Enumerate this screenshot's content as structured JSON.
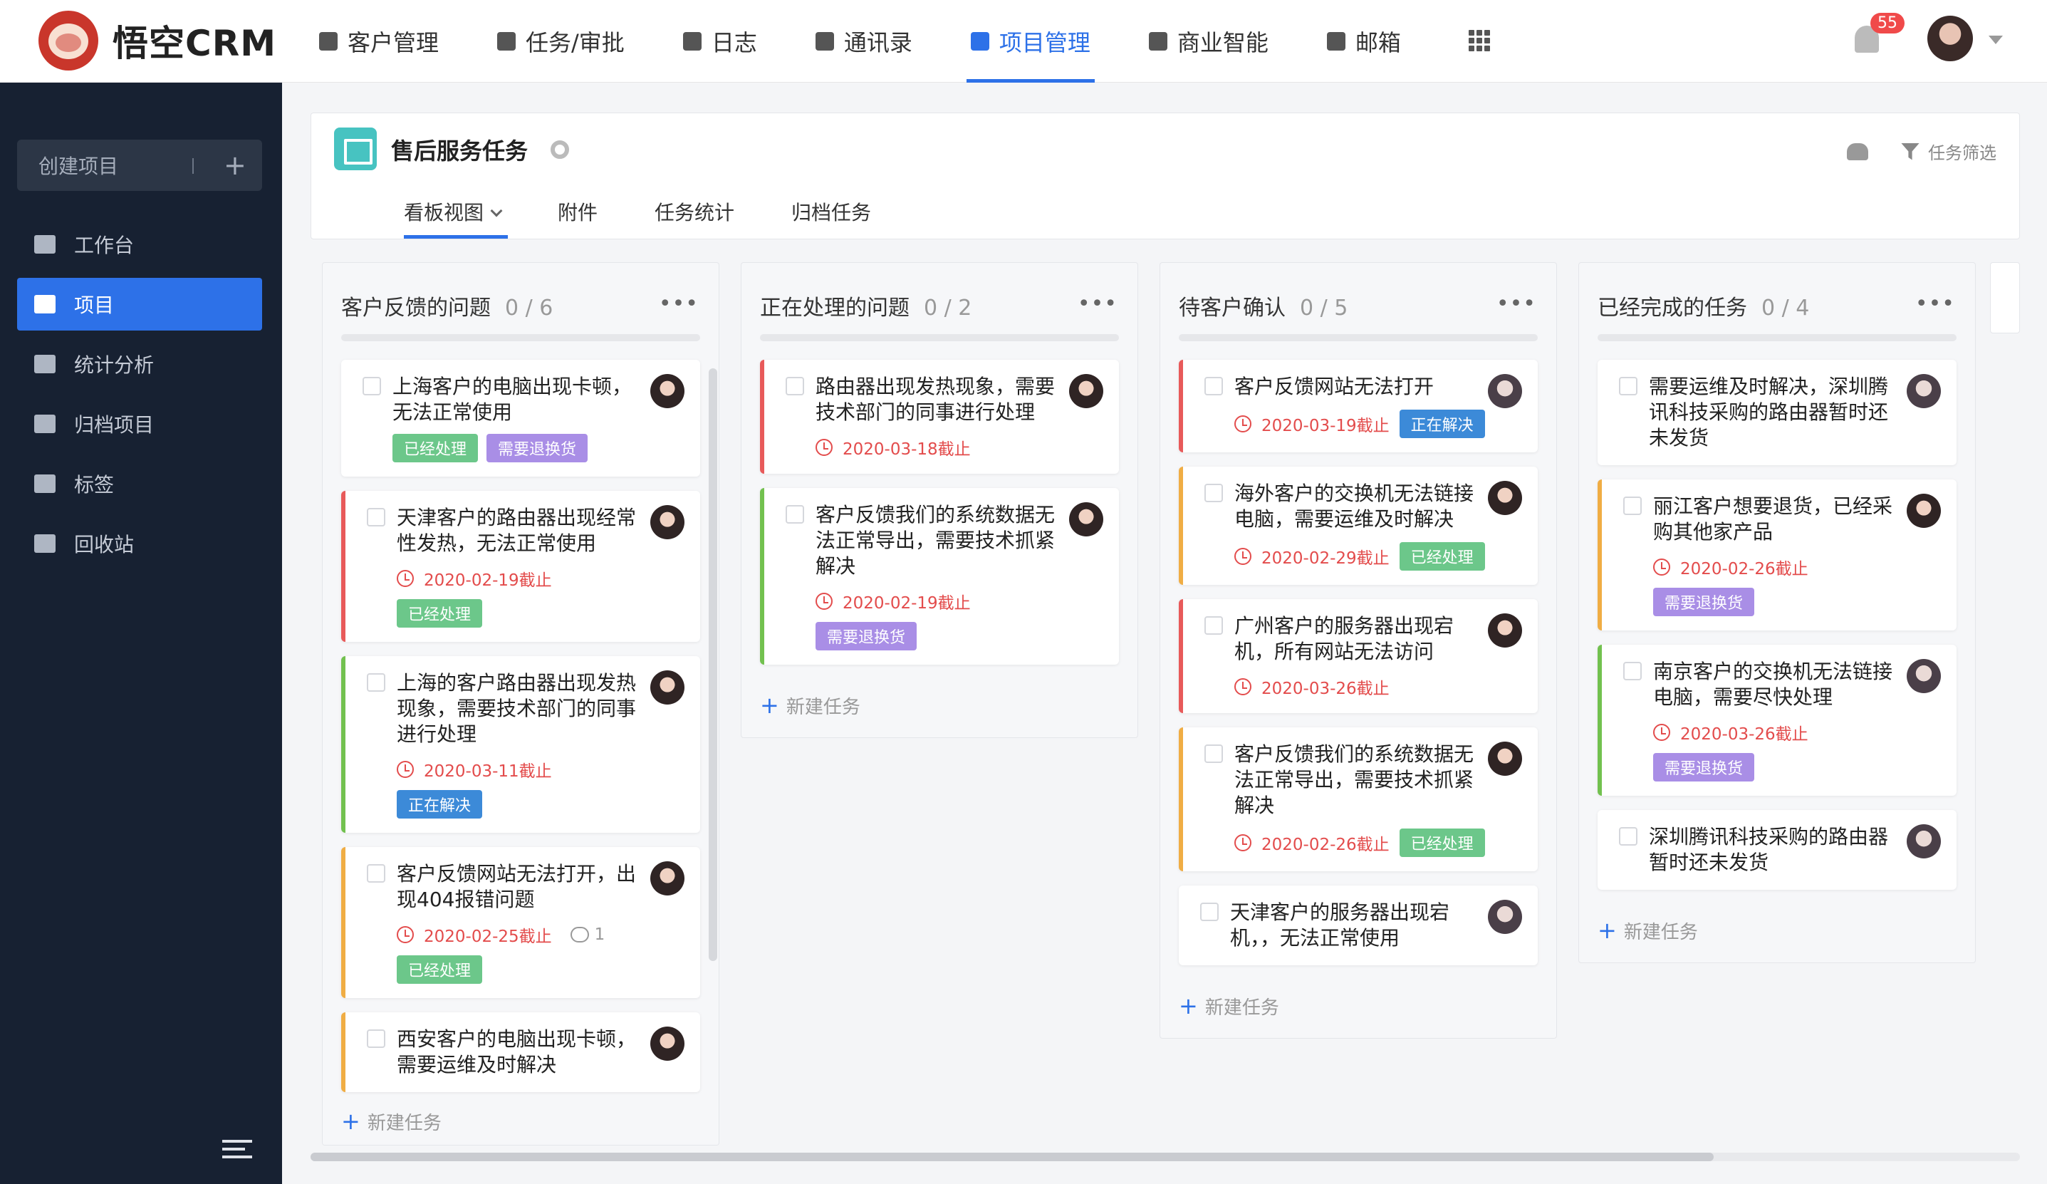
{
  "brand": {
    "name": "悟空CRM"
  },
  "nav": [
    {
      "label": "客户管理",
      "icon": "building-icon"
    },
    {
      "label": "任务/审批",
      "icon": "briefcase-icon"
    },
    {
      "label": "日志",
      "icon": "notebook-icon"
    },
    {
      "label": "通讯录",
      "icon": "phone-book-icon"
    },
    {
      "label": "项目管理",
      "icon": "project-icon",
      "active": true
    },
    {
      "label": "商业智能",
      "icon": "shield-icon"
    },
    {
      "label": "邮箱",
      "icon": "mail-icon"
    }
  ],
  "notifications": {
    "count": "55"
  },
  "sidebar": {
    "create": {
      "label": "创建项目",
      "plus": "+"
    },
    "items": [
      {
        "label": "工作台",
        "icon": "monitor-icon"
      },
      {
        "label": "项目",
        "icon": "list-icon",
        "active": true
      },
      {
        "label": "统计分析",
        "icon": "bar-chart-icon"
      },
      {
        "label": "归档项目",
        "icon": "archive-icon"
      },
      {
        "label": "标签",
        "icon": "tag-icon"
      },
      {
        "label": "回收站",
        "icon": "trash-icon"
      }
    ]
  },
  "project": {
    "title": "售后服务任务",
    "filter_label": "任务筛选",
    "tabs": [
      "看板视图",
      "附件",
      "任务统计",
      "归档任务"
    ]
  },
  "new_task_label": "新建任务",
  "columns": [
    {
      "title": "客户反馈的问题",
      "count": "0 / 6",
      "tasks": [
        {
          "title": "上海客户的电脑出现卡顿，无法正常使用",
          "color": "none",
          "due": "",
          "tags": [
            {
              "t": "已经处理",
              "c": "g"
            },
            {
              "t": "需要退换货",
              "c": "p"
            }
          ]
        },
        {
          "title": "天津客户的路由器出现经常性发热，无法正常使用",
          "color": "red",
          "due": "2020-02-19截止",
          "tags": [
            {
              "t": "已经处理",
              "c": "g"
            }
          ]
        },
        {
          "title": "上海的客户路由器出现发热现象，需要技术部门的同事进行处理",
          "color": "green",
          "due": "2020-03-11截止",
          "tags": [
            {
              "t": "正在解决",
              "c": "bl"
            }
          ]
        },
        {
          "title": "客户反馈网站无法打开，出现404报错问题",
          "color": "orange",
          "due": "2020-02-25截止",
          "comments": "1",
          "tags": [
            {
              "t": "已经处理",
              "c": "g"
            }
          ]
        },
        {
          "title": "西安客户的电脑出现卡顿，需要运维及时解决",
          "color": "orange",
          "due": "",
          "tags": []
        }
      ]
    },
    {
      "title": "正在处理的问题",
      "count": "0 / 2",
      "tasks": [
        {
          "title": "路由器出现发热现象，需要技术部门的同事进行处理",
          "color": "red",
          "due": "2020-03-18截止",
          "tags": []
        },
        {
          "title": "客户反馈我们的系统数据无法正常导出，需要技术抓紧解决",
          "color": "green",
          "due": "2020-02-19截止",
          "tags": [
            {
              "t": "需要退换货",
              "c": "p"
            }
          ]
        }
      ]
    },
    {
      "title": "待客户确认",
      "count": "0 / 5",
      "tasks": [
        {
          "title": "客户反馈网站无法打开",
          "color": "red",
          "due": "2020-03-19截止",
          "tags": [
            {
              "t": "正在解决",
              "c": "bl"
            }
          ],
          "inline": true,
          "avb": true
        },
        {
          "title": "海外客户的交换机无法链接电脑，需要运维及时解决",
          "color": "orange",
          "due": "2020-02-29截止",
          "tags": [
            {
              "t": "已经处理",
              "c": "g"
            }
          ],
          "inline": true
        },
        {
          "title": "广州客户的服务器出现宕机，所有网站无法访问",
          "color": "red",
          "due": "2020-03-26截止",
          "tags": []
        },
        {
          "title": "客户反馈我们的系统数据无法正常导出，需要技术抓紧解决",
          "color": "orange",
          "due": "2020-02-26截止",
          "tags": [
            {
              "t": "已经处理",
              "c": "g"
            }
          ],
          "inline": true
        },
        {
          "title": "天津客户的服务器出现宕机，，无法正常使用",
          "color": "none",
          "due": "",
          "tags": [],
          "avb": true
        }
      ]
    },
    {
      "title": "已经完成的任务",
      "count": "0 / 4",
      "tasks": [
        {
          "title": "需要运维及时解决，深圳腾讯科技采购的路由器暂时还未发货",
          "color": "none",
          "due": "",
          "tags": [],
          "avb": true
        },
        {
          "title": "丽江客户想要退货，已经采购其他家产品",
          "color": "orange",
          "due": "2020-02-26截止",
          "tags": [
            {
              "t": "需要退换货",
              "c": "p"
            }
          ]
        },
        {
          "title": "南京客户的交换机无法链接电脑，需要尽快处理",
          "color": "green",
          "due": "2020-03-26截止",
          "tags": [
            {
              "t": "需要退换货",
              "c": "p"
            }
          ],
          "avb": true
        },
        {
          "title": "深圳腾讯科技采购的路由器暂时还未发货",
          "color": "none",
          "due": "",
          "tags": [],
          "avb": true
        }
      ]
    }
  ]
}
